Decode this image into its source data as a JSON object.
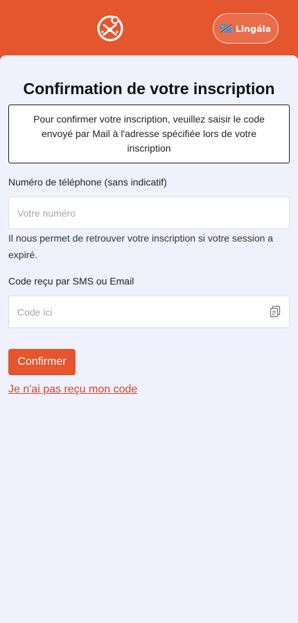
{
  "header": {
    "language_label": "Lingála",
    "language_flag": "drc-flag-icon",
    "logo": "cookie-logo-icon",
    "brand_color": "#e5552e"
  },
  "main": {
    "title": "Confirmation de votre inscription",
    "notice": "Pour confirmer votre inscription, veuillez saisir le code envoyé par Mail à l'adresse spécifiée lors de votre inscription",
    "phone": {
      "label": "Numéro de téléphone (sans indicatif)",
      "placeholder": "Votre numéro",
      "value": "",
      "help": "Il nous permet de retrouver votre inscription si votre session a expiré."
    },
    "code": {
      "label": "Code reçu par SMS ou Email",
      "placeholder": "Code ici",
      "value": "",
      "icon": "paste-icon"
    },
    "confirm_label": "Confirmer",
    "resend_label": "Je n'ai pas reçu mon code"
  },
  "colors": {
    "accent": "#e5552e",
    "background": "#eff1fc",
    "link": "#d6452a"
  }
}
